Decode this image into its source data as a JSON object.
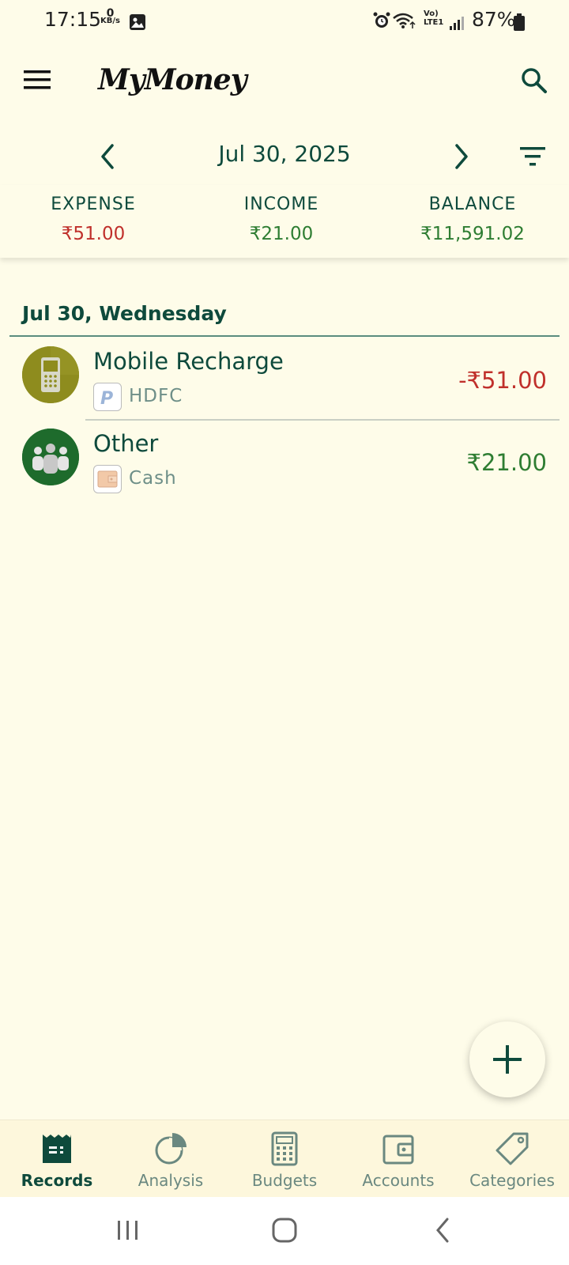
{
  "status_bar": {
    "time": "17:15",
    "net_speed_value": "0",
    "net_speed_unit": "KB/s",
    "network_label_top": "Vo)",
    "network_label_bottom": "LTE1",
    "battery_percent": "87%"
  },
  "app": {
    "title": "MyMoney"
  },
  "date_nav": {
    "current_date": "Jul 30, 2025"
  },
  "summary": {
    "expense_label": "EXPENSE",
    "expense_value": "₹51.00",
    "income_label": "INCOME",
    "income_value": "₹21.00",
    "balance_label": "BALANCE",
    "balance_value": "₹11,591.02"
  },
  "records": {
    "day_header": "Jul 30, Wednesday",
    "items": [
      {
        "title": "Mobile Recharge",
        "account": "HDFC",
        "amount": "-₹51.00",
        "category_icon": "mobile-phone-icon",
        "account_icon": "paypal-icon",
        "type": "expense"
      },
      {
        "title": "Other",
        "account": "Cash",
        "amount": "₹21.00",
        "category_icon": "people-group-icon",
        "account_icon": "wallet-icon",
        "type": "income"
      }
    ]
  },
  "bottom_nav": {
    "items": [
      {
        "label": "Records",
        "icon": "records-icon",
        "active": true
      },
      {
        "label": "Analysis",
        "icon": "pie-chart-icon",
        "active": false
      },
      {
        "label": "Budgets",
        "icon": "calculator-icon",
        "active": false
      },
      {
        "label": "Accounts",
        "icon": "wallet-icon",
        "active": false
      },
      {
        "label": "Categories",
        "icon": "tag-icon",
        "active": false
      }
    ]
  },
  "colors": {
    "background": "#FEFCE9",
    "primary": "#0E4A3C",
    "expense": "#C0302B",
    "income": "#2E7D32"
  }
}
